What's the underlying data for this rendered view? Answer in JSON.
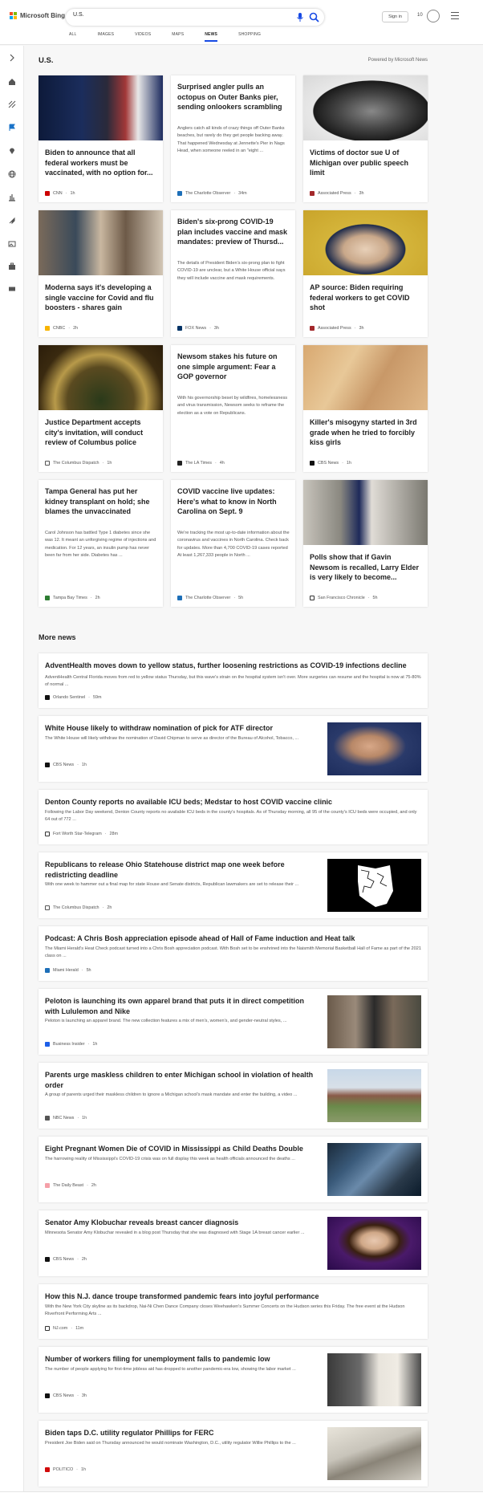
{
  "header": {
    "logo_text": "Microsoft Bing",
    "search_value": "U.S.",
    "signin": "Sign in",
    "points": "10"
  },
  "tabs": [
    "ALL",
    "IMAGES",
    "VIDEOS",
    "MAPS",
    "NEWS",
    "SHOPPING"
  ],
  "active_tab": "NEWS",
  "section": {
    "title": "U.S.",
    "powered_by": "Powered by Microsoft News"
  },
  "cards": [
    {
      "title": "Biden to announce that all federal workers must be vaccinated, with no option for...",
      "snippet": "",
      "source": "CNN",
      "time": "1h"
    },
    {
      "title": "Surprised angler pulls an octopus on Outer Banks pier, sending onlookers scrambling",
      "snippet": "Anglers catch all kinds of crazy things off Outer Banks beaches, but rarely do they get people backing away. That happened Wednesday at Jennette's Pier in Nags Head, when someone reeled in an \"eight ...",
      "source": "The Charlotte Observer",
      "time": "34m"
    },
    {
      "title": "Victims of doctor sue U of Michigan over public speech limit",
      "snippet": "",
      "source": "Associated Press",
      "time": "3h"
    },
    {
      "title": "Moderna says it's developing a single vaccine for Covid and flu boosters - shares gain",
      "snippet": "",
      "source": "CNBC",
      "time": "2h"
    },
    {
      "title": "Biden's six-prong COVID-19 plan includes vaccine and mask mandates: preview of Thursd...",
      "snippet": "The details of President Biden's six-prong plan to fight COVID-19 are unclear, but a White House official says they will include vaccine and mask requirements.",
      "source": "FOX News",
      "time": "3h"
    },
    {
      "title": "AP source: Biden requiring federal workers to get COVID shot",
      "snippet": "",
      "source": "Associated Press",
      "time": "3h"
    },
    {
      "title": "Justice Department accepts city's invitation, will conduct review of Columbus police",
      "snippet": "",
      "source": "The Columbus Dispatch",
      "time": "1h"
    },
    {
      "title": "Newsom stakes his future on one simple argument: Fear a GOP governor",
      "snippet": "With his governorship beset by wildfires, homelessness and virus transmission, Newsom seeks to reframe the election as a vote on Republicans.",
      "source": "The LA Times",
      "time": "4h"
    },
    {
      "title": "Killer's misogyny started in 3rd grade when he tried to forcibly kiss girls",
      "snippet": "",
      "source": "CBS News",
      "time": "1h"
    },
    {
      "title": "Tampa General has put her kidney transplant on hold; she blames the unvaccinated",
      "snippet": "Carol Johnson has battled Type 1 diabetes since she was 12. It meant an unforgiving regime of injections and medication. For 12 years, an insulin pump has never been far from her side. Diabetes has ...",
      "source": "Tampa Bay Times",
      "time": "2h"
    },
    {
      "title": "COVID vaccine live updates: Here's what to know in North Carolina on Sept. 9",
      "snippet": "We're tracking the most up-to-date information about the coronavirus and vaccines in North Carolina. Check back for updates. More than 4,700 COVID-19 cases reported At least 1,267,333 people in North ...",
      "source": "The Charlotte Observer",
      "time": "5h"
    },
    {
      "title": "Polls show that if Gavin Newsom is recalled, Larry Elder is very likely to become...",
      "snippet": "",
      "source": "San Francisco Chronicle",
      "time": "5h"
    }
  ],
  "more_news_title": "More news",
  "news": [
    {
      "title": "AdventHealth moves down to yellow status, further loosening restrictions as COVID-19 infections decline",
      "snippet": "AdventHealth Central Florida moves from red to yellow status Thursday, but this wave's strain on the hospital system isn't over. More surgeries can resume and the hospital is now at 75-80% of normal ...",
      "source": "Orlando Sentinel",
      "time": "59m"
    },
    {
      "title": "White House likely to withdraw nomination of pick for ATF director",
      "snippet": "The White House will likely withdraw the nomination of David Chipman to serve as director of the Bureau of Alcohol, Tobacco, ...",
      "source": "CBS News",
      "time": "1h"
    },
    {
      "title": "Denton County reports no available ICU beds; Medstar to host COVID vaccine clinic",
      "snippet": "Following the Labor Day weekend, Denton County reports no available ICU beds in the county's hospitals. As of Thursday morning, all 95 of the county's ICU beds were occupied, and only 64 out of 772 ...",
      "source": "Fort Worth Star-Telegram",
      "time": "28m"
    },
    {
      "title": "Republicans to release Ohio Statehouse district map one week before redistricting deadline",
      "snippet": "With one week to hammer out a final map for state House and Senate districts, Republican lawmakers are set to release their ...",
      "source": "The Columbus Dispatch",
      "time": "2h"
    },
    {
      "title": "Podcast: A Chris Bosh appreciation episode ahead of Hall of Fame induction and Heat talk",
      "snippet": "The Miami Herald's Heat Check podcast turned into a Chris Bosh appreciation podcast. With Bosh set to be enshrined into the Naismith Memorial Basketball Hall of Fame as part of the 2021 class on ...",
      "source": "Miami Herald",
      "time": "5h"
    },
    {
      "title": "Peloton is launching its own apparel brand that puts it in direct competition with Lululemon and Nike",
      "snippet": "Peloton is launching an apparel brand. The new collection features a mix of men's, women's, and gender-neutral styles, ...",
      "source": "Business Insider",
      "time": "1h"
    },
    {
      "title": "Parents urge maskless children to enter Michigan school in violation of health order",
      "snippet": "A group of parents urged their maskless children to ignore a Michigan school's mask mandate and enter the building, a video ...",
      "source": "NBC News",
      "time": "1h"
    },
    {
      "title": "Eight Pregnant Women Die of COVID in Mississippi as Child Deaths Double",
      "snippet": "The harrowing reality of Mississippi's COVID-19 crisis was on full display this week as health officials announced the deaths ...",
      "source": "The Daily Beast",
      "time": "2h"
    },
    {
      "title": "Senator Amy Klobuchar reveals breast cancer diagnosis",
      "snippet": "Minnesota Senator Amy Klobuchar revealed in a blog post Thursday that she was diagnosed with Stage 1A breast cancer earlier ...",
      "source": "CBS News",
      "time": "2h"
    },
    {
      "title": "How this N.J. dance troupe transformed pandemic fears into joyful performance",
      "snippet": "With the New York City skyline as its backdrop, Nai-Ni Chen Dance Company closes Weehawken's Summer Concerts on the Hudson series this Friday. The free event at the Hudson Riverfront Performing Arts ...",
      "source": "NJ.com",
      "time": "11m"
    },
    {
      "title": "Number of workers filing for unemployment falls to pandemic low",
      "snippet": "The number of people applying for first-time jobless aid has dropped to another pandemic-era low, showing the labor market ...",
      "source": "CBS News",
      "time": "3h"
    },
    {
      "title": "Biden taps D.C. utility regulator Phillips for FERC",
      "snippet": "President Joe Biden said on Thursday announced he would nominate Washington, D.C., utility regulator Willie Phillips to the ...",
      "source": "POLITICO",
      "time": "1h"
    }
  ]
}
